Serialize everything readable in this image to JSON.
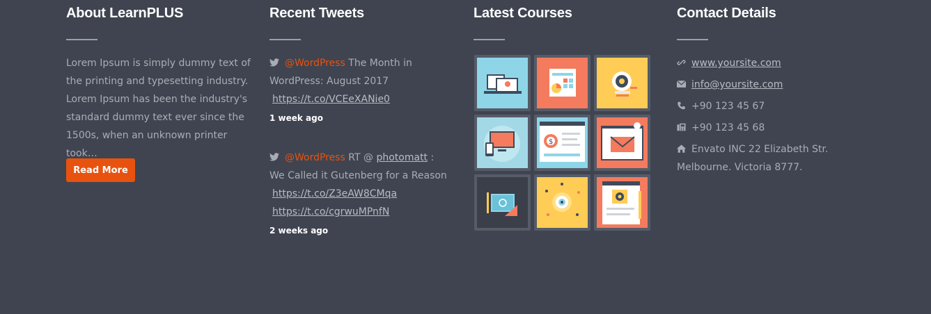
{
  "about": {
    "title": "About LearnPLUS",
    "text": "Lorem Ipsum is simply dummy text of the printing and typesetting industry. Lorem Ipsum has been the industry's standard dummy text ever since the 1500s, when an unknown printer took…",
    "button_label": "Read More"
  },
  "tweets": {
    "title": "Recent Tweets",
    "items": [
      {
        "handle": "@WordPress",
        "text": " The Month in WordPress: August 2017",
        "links": [
          "https://t.co/VCEeXANie0"
        ],
        "time": "1 week ago"
      },
      {
        "handle": "@WordPress",
        "text_before": " RT @ ",
        "mention": "photomatt",
        "text_after": " : We Called it Gutenberg for a Reason",
        "links": [
          "https://t.co/Z3eAW8CMqa",
          "https://t.co/cgrwuMPnfN"
        ],
        "time": "2 weeks ago"
      }
    ]
  },
  "courses": {
    "title": "Latest Courses",
    "thumbnails": [
      {
        "icon": "books-laptop-icon",
        "bg": "#8fd5e8"
      },
      {
        "icon": "analytics-dashboard-icon",
        "bg": "#f47b5e"
      },
      {
        "icon": "gear-idea-icon",
        "bg": "#ffcc55"
      },
      {
        "icon": "devices-icon",
        "bg": "#a3d9e6"
      },
      {
        "icon": "finance-browser-icon",
        "bg": "#f3f3f3"
      },
      {
        "icon": "email-newsletter-icon",
        "bg": "#f47b5e"
      },
      {
        "icon": "drawing-tablet-icon",
        "bg": "#3a3f4a"
      },
      {
        "icon": "eye-network-icon",
        "bg": "#ffcc55"
      },
      {
        "icon": "web-settings-icon",
        "bg": "#f47b5e"
      }
    ]
  },
  "contact": {
    "title": "Contact Details",
    "website": "www.yoursite.com",
    "email": "info@yoursite.com",
    "phone": "+90 123 45 67",
    "fax": "+90 123 45 68",
    "address": "Envato INC 22 Elizabeth Str. Melbourne. Victoria 8777."
  },
  "colors": {
    "background": "#3f4450",
    "accent": "#e8520f",
    "title": "#ffffff",
    "text": "#a8adb5"
  }
}
